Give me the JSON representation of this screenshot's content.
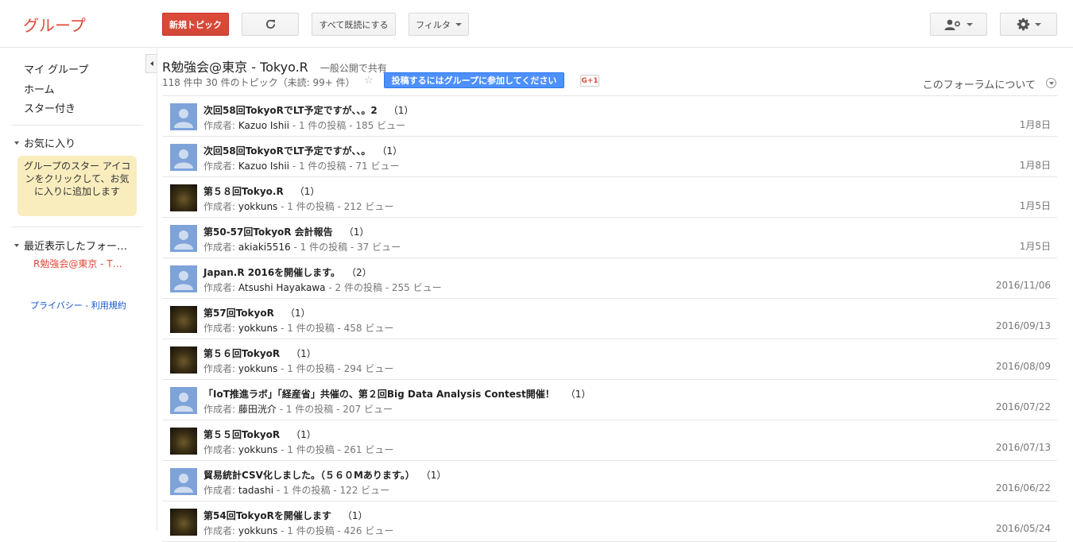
{
  "header": {
    "logo": "グループ",
    "new_topic": "新規トピック",
    "mark_all_read": "すべて既読にする",
    "filter": "フィルタ"
  },
  "sidebar": {
    "nav": [
      "マイ グループ",
      "ホーム",
      "スター付き"
    ],
    "favorites_label": "お気に入り",
    "favorites_hint": "グループのスター アイコンをクリックして、お気に入りに追加します",
    "recent_label": "最近表示したフォー…",
    "recent_item": "R勉強会@東京 - T…",
    "footer": {
      "privacy": "プライバシー",
      "sep": " - ",
      "terms": "利用規約"
    }
  },
  "forum": {
    "title": "R勉強会@東京 - Tokyo.R",
    "visibility": "一般公開で共有",
    "summary": "118 件中 30 件のトピック（未読: 99+ 件）",
    "join_button": "投稿するにはグループに参加してください",
    "gplus": "G+1",
    "about": "このフォーラムについて"
  },
  "author_prefix": "作成者: ",
  "topics": [
    {
      "title": "次回58回TokyoRでLT予定ですが、、。2",
      "count": "（1）",
      "author": "Kazuo Ishii",
      "stats": " - 1 件の投稿 - 185 ビュー",
      "date": "1月8日",
      "avatar": "generic"
    },
    {
      "title": "次回58回TokyoRでLT予定ですが、、。",
      "count": "（1）",
      "author": "Kazuo Ishii",
      "stats": " - 1 件の投稿 - 71 ビュー",
      "date": "1月8日",
      "avatar": "generic"
    },
    {
      "title": "第５８回Tokyo.R",
      "count": "（1）",
      "author": "yokkuns",
      "stats": " - 1 件の投稿 - 212 ビュー",
      "date": "1月5日",
      "avatar": "photo"
    },
    {
      "title": "第50-57回TokyoR 会計報告",
      "count": "（1）",
      "author": "akiaki5516",
      "stats": " - 1 件の投稿 - 37 ビュー",
      "date": "1月5日",
      "avatar": "generic"
    },
    {
      "title": "Japan.R 2016を開催します。",
      "count": "（2）",
      "author": "Atsushi Hayakawa",
      "stats": " - 2 件の投稿 - 255 ビュー",
      "date": "2016/11/06",
      "avatar": "generic"
    },
    {
      "title": "第57回TokyoR",
      "count": "（1）",
      "author": "yokkuns",
      "stats": " - 1 件の投稿 - 458 ビュー",
      "date": "2016/09/13",
      "avatar": "photo"
    },
    {
      "title": "第５６回TokyoR",
      "count": "（1）",
      "author": "yokkuns",
      "stats": " - 1 件の投稿 - 294 ビュー",
      "date": "2016/08/09",
      "avatar": "photo"
    },
    {
      "title": "「IoT推進ラボ」「経産省」共催の、第２回Big Data Analysis Contest開催！",
      "count": "（1）",
      "author": "藤田洸介",
      "stats": " - 1 件の投稿 - 207 ビュー",
      "date": "2016/07/22",
      "avatar": "generic"
    },
    {
      "title": "第５５回TokyoR",
      "count": "（1）",
      "author": "yokkuns",
      "stats": " - 1 件の投稿 - 261 ビュー",
      "date": "2016/07/13",
      "avatar": "photo"
    },
    {
      "title": "貿易統計CSV化しました。（５６０Mあります。）",
      "count": "（1）",
      "author": "tadashi",
      "stats": " - 1 件の投稿 - 122 ビュー",
      "date": "2016/06/22",
      "avatar": "generic"
    },
    {
      "title": "第54回TokyoRを開催します",
      "count": "（1）",
      "author": "yokkuns",
      "stats": " - 1 件の投稿 - 426 ビュー",
      "date": "2016/05/24",
      "avatar": "photo"
    }
  ]
}
